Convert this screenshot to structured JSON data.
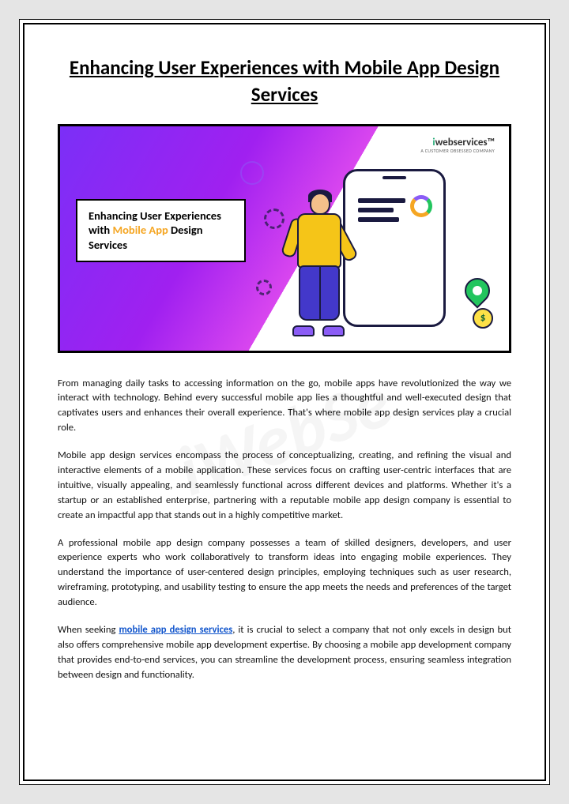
{
  "title": "Enhancing User Experiences with Mobile App Design Services",
  "hero": {
    "brand_i": "i",
    "brand_rest": "webservices",
    "brand_tm": "™",
    "brand_tag": "A CUSTOMER OBSESSED COMPANY",
    "text_prefix": "Enhancing User Experiences with ",
    "text_highlight": "Mobile App",
    "text_suffix": " Design Services",
    "coin_symbol": "$"
  },
  "paragraphs": {
    "p1": "From managing daily tasks to accessing information on the go, mobile apps have revolutionized the way we interact with technology. Behind every successful mobile app lies a thoughtful and well-executed design that captivates users and enhances their overall experience. That's where mobile app design services play a crucial role.",
    "p2": "Mobile app design services encompass the process of conceptualizing, creating, and refining the visual and interactive elements of a mobile application. These services focus on crafting user-centric interfaces that are intuitive, visually appealing, and seamlessly functional across different devices and platforms. Whether it's a startup or an established enterprise, partnering with a reputable mobile app design company is essential to create an impactful app that stands out in a highly competitive market.",
    "p3": "A professional mobile app design company possesses a team of skilled designers, developers, and user experience experts who work collaboratively to transform ideas into engaging mobile experiences. They understand the importance of user-centered design principles, employing techniques such as user research, wireframing, prototyping, and usability testing to ensure the app meets the needs and preferences of the target audience.",
    "p4_prefix": "When seeking ",
    "p4_link": "mobile app design services",
    "p4_suffix": ", it is crucial to select a company that not only excels in design but also offers comprehensive mobile app development expertise. By choosing a mobile app development company that provides end-to-end services, you can streamline the development process, ensuring seamless integration between design and functionality."
  },
  "watermark": "iWebSe"
}
